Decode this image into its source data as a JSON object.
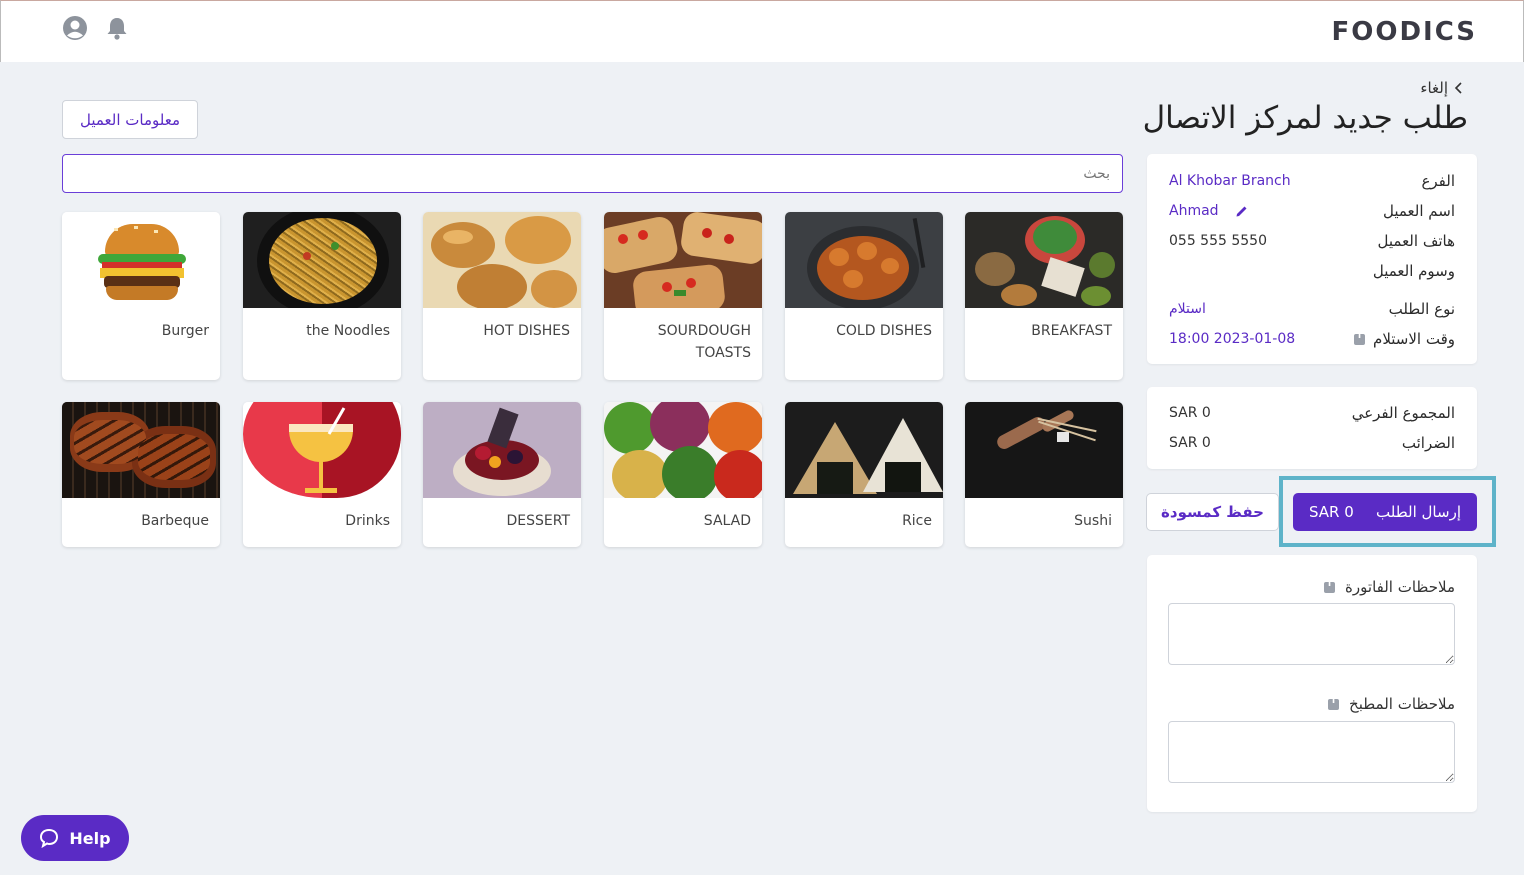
{
  "brand": {
    "logo_text": "FOODICS",
    "accent": "#5a2bc5"
  },
  "header": {
    "user_icon": "user-circle-icon",
    "bell_icon": "bell-icon"
  },
  "page": {
    "back_label": "إلغاء",
    "title": "طلب جديد لمركز الاتصال"
  },
  "customer_info_button": "معلومات العميل",
  "search": {
    "placeholder": "بحث"
  },
  "categories": [
    {
      "label": "BREAKFAST"
    },
    {
      "label": "COLD DISHES"
    },
    {
      "label": "SOURDOUGH TOASTS"
    },
    {
      "label": "HOT DISHES"
    },
    {
      "label": "the Noodles"
    },
    {
      "label": "Burger"
    },
    {
      "label": "Sushi"
    },
    {
      "label": "Rice"
    },
    {
      "label": "SALAD"
    },
    {
      "label": "DESSERT"
    },
    {
      "label": "Drinks"
    },
    {
      "label": "Barbeque"
    }
  ],
  "order_info": {
    "branch_label": "الفرع",
    "branch_value": "Al Khobar Branch",
    "customer_name_label": "اسم العميل",
    "customer_name_value": "Ahmad",
    "customer_phone_label": "هاتف العميل",
    "customer_phone_value": "055 555 5550",
    "customer_tags_label": "وسوم العميل",
    "order_type_label": "نوع الطلب",
    "order_type_value": "استلام",
    "pickup_time_label": "وقت الاستلام",
    "pickup_time_value": "18:00 2023-01-08"
  },
  "totals": {
    "subtotal_label": "المجموع الفرعي",
    "subtotal_value": "SAR 0",
    "tax_label": "الضرائب",
    "tax_value": "SAR 0"
  },
  "actions": {
    "send_label": "إرسال الطلب",
    "send_amount": "SAR 0",
    "draft_label": "حفظ كمسودة"
  },
  "notes": {
    "invoice_label": "ملاحظات الفاتورة",
    "kitchen_label": "ملاحظات المطبخ"
  },
  "help_label": "Help"
}
